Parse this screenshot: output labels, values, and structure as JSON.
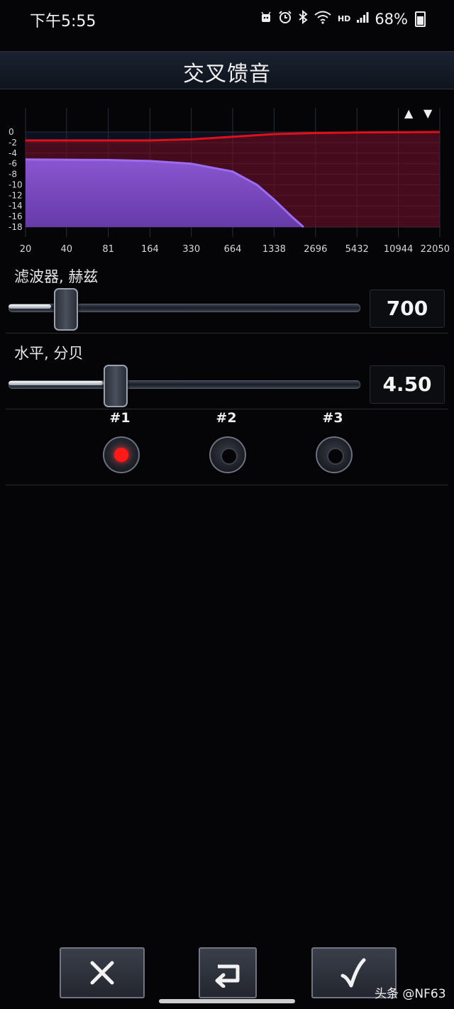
{
  "status_bar": {
    "time": "下午5:55",
    "hd_label": "HD",
    "battery": "68%"
  },
  "header": {
    "title": "交叉馈音"
  },
  "chart_data": {
    "type": "area",
    "x_ticks": [
      "20",
      "40",
      "81",
      "164",
      "330",
      "664",
      "1338",
      "2696",
      "5432",
      "10944",
      "22050"
    ],
    "y_ticks": [
      "0",
      "-2",
      "-4",
      "-6",
      "-8",
      "-10",
      "-12",
      "-14",
      "-16",
      "-18"
    ],
    "ylim": [
      -18,
      0
    ],
    "x_scale": "log",
    "series": [
      {
        "color": "#e0101a",
        "x": [
          20,
          81,
          164,
          330,
          664,
          1338,
          2696,
          5432,
          10944,
          22050
        ],
        "y": [
          -1.6,
          -1.6,
          -1.6,
          -1.4,
          -0.9,
          -0.4,
          -0.2,
          -0.1,
          -0.05,
          0
        ]
      },
      {
        "color": "#9b6cf2",
        "x": [
          20,
          81,
          164,
          330,
          664,
          1000,
          1338,
          1800,
          2200
        ],
        "y": [
          -5.2,
          -5.3,
          -5.5,
          -6.0,
          -7.5,
          -10.0,
          -12.8,
          -16.0,
          -18
        ]
      }
    ]
  },
  "chart_controls": {
    "up_arrow": "▲",
    "down_arrow": "▼"
  },
  "filter": {
    "label": "滤波器, 赫兹",
    "value": "700",
    "level": 0.16
  },
  "level": {
    "label": "水平, 分贝",
    "value": "4.50",
    "level": 0.3
  },
  "presets": [
    {
      "label": "#1",
      "active": true,
      "color": "#ff1a1a"
    },
    {
      "label": "#2",
      "active": false,
      "color": "#050507"
    },
    {
      "label": "#3",
      "active": false,
      "color": "#050507"
    }
  ],
  "bottom": {
    "cancel_icon": "close-icon",
    "reset_icon": "undo-icon",
    "confirm_icon": "check-icon"
  },
  "watermark": "头条 @NF63"
}
